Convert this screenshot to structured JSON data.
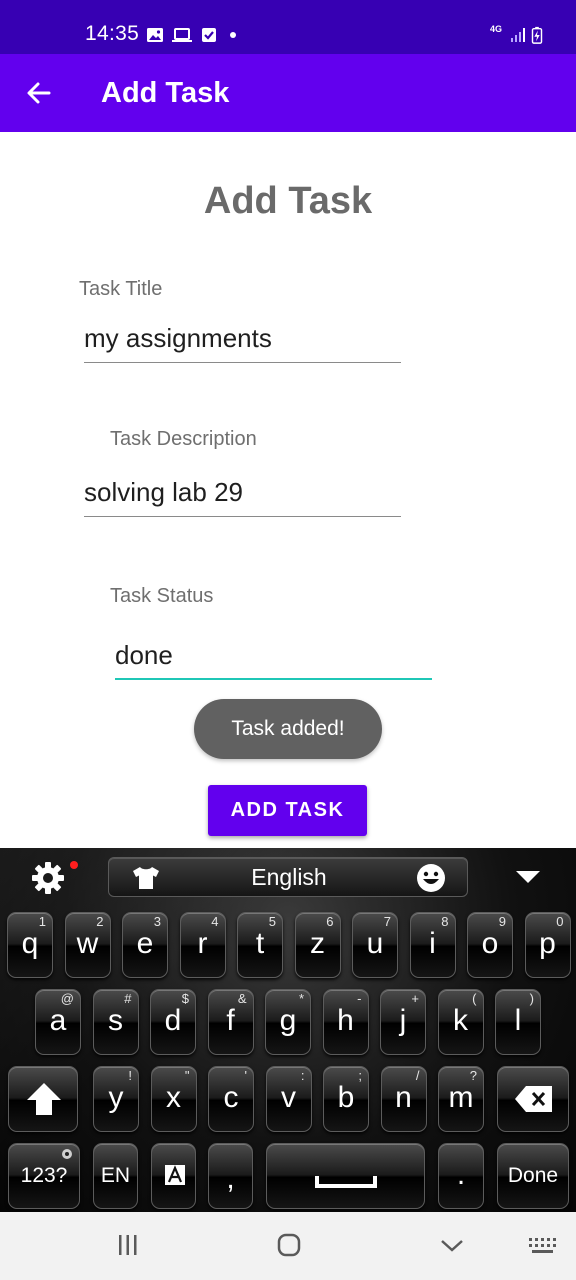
{
  "status_bar": {
    "time": "14:35",
    "network": "4G",
    "icons": [
      "gallery-icon",
      "laptop-icon",
      "checkbox-icon",
      "dot-icon",
      "signal-icon",
      "battery-charging-icon"
    ]
  },
  "app_bar": {
    "title": "Add Task",
    "back_icon": "arrow-left-icon"
  },
  "form": {
    "heading": "Add Task",
    "title_label": "Task Title",
    "title_value": "my assignments",
    "description_label": "Task Description",
    "description_value": "solving lab 29",
    "status_label": "Task Status",
    "status_value": "done",
    "submit_label": "ADD TASK"
  },
  "toast": {
    "message": "Task added!"
  },
  "keyboard": {
    "language": "English",
    "row1": [
      {
        "key": "q",
        "hint": "1"
      },
      {
        "key": "w",
        "hint": "2"
      },
      {
        "key": "e",
        "hint": "3"
      },
      {
        "key": "r",
        "hint": "4"
      },
      {
        "key": "t",
        "hint": "5"
      },
      {
        "key": "z",
        "hint": "6"
      },
      {
        "key": "u",
        "hint": "7"
      },
      {
        "key": "i",
        "hint": "8"
      },
      {
        "key": "o",
        "hint": "9"
      },
      {
        "key": "p",
        "hint": "0"
      }
    ],
    "row2": [
      {
        "key": "a",
        "hint": "@"
      },
      {
        "key": "s",
        "hint": "#"
      },
      {
        "key": "d",
        "hint": "$"
      },
      {
        "key": "f",
        "hint": "&"
      },
      {
        "key": "g",
        "hint": "*"
      },
      {
        "key": "h",
        "hint": "-"
      },
      {
        "key": "j",
        "hint": "+"
      },
      {
        "key": "k",
        "hint": "("
      },
      {
        "key": "l",
        "hint": ")"
      }
    ],
    "row3": [
      {
        "key": "y",
        "hint": "!"
      },
      {
        "key": "x",
        "hint": "\""
      },
      {
        "key": "c",
        "hint": "'"
      },
      {
        "key": "v",
        "hint": ":"
      },
      {
        "key": "b",
        "hint": ";"
      },
      {
        "key": "n",
        "hint": "/"
      },
      {
        "key": "m",
        "hint": "?"
      }
    ],
    "symbols_label": "123?",
    "lang_key_label": "EN",
    "comma_label": ",",
    "period_label": ".",
    "done_label": "Done"
  },
  "colors": {
    "status_bar": "#3700b3",
    "primary": "#6200ee",
    "focus_underline": "#1fc7b6",
    "toast_bg": "#616161"
  }
}
